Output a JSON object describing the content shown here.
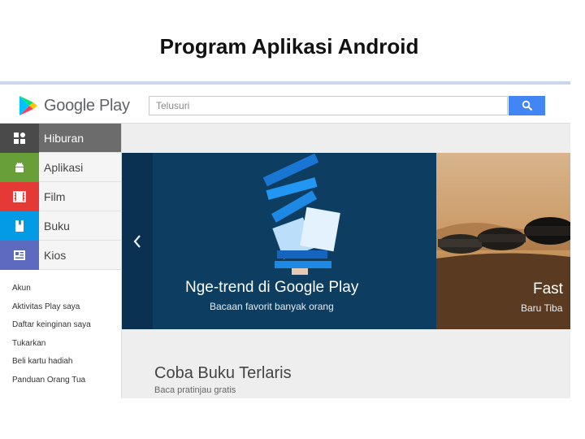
{
  "slide": {
    "title": "Program Aplikasi Android"
  },
  "header": {
    "brand": "Google Play",
    "search_placeholder": "Telusuri"
  },
  "sidebar": {
    "categories": [
      {
        "label": "Hiburan",
        "icon": "grid-icon",
        "color": "#4a4a4a"
      },
      {
        "label": "Aplikasi",
        "icon": "android-icon",
        "color": "#689f38"
      },
      {
        "label": "Film",
        "icon": "film-icon",
        "color": "#e53935"
      },
      {
        "label": "Buku",
        "icon": "book-icon",
        "color": "#039be5"
      },
      {
        "label": "Kios",
        "icon": "newsstand-icon",
        "color": "#5c6bc0"
      }
    ],
    "links": [
      "Akun",
      "Aktivitas Play saya",
      "Daftar keinginan saya",
      "Tukarkan",
      "Beli kartu hadiah",
      "Panduan Orang Tua"
    ]
  },
  "carousel": {
    "banner1": {
      "title": "Nge-trend di Google Play",
      "subtitle": "Bacaan favorit banyak orang"
    },
    "banner2": {
      "title": "Fast",
      "subtitle": "Baru Tiba"
    }
  },
  "section": {
    "title": "Coba Buku Terlaris",
    "subtitle": "Baca pratinjau gratis"
  }
}
